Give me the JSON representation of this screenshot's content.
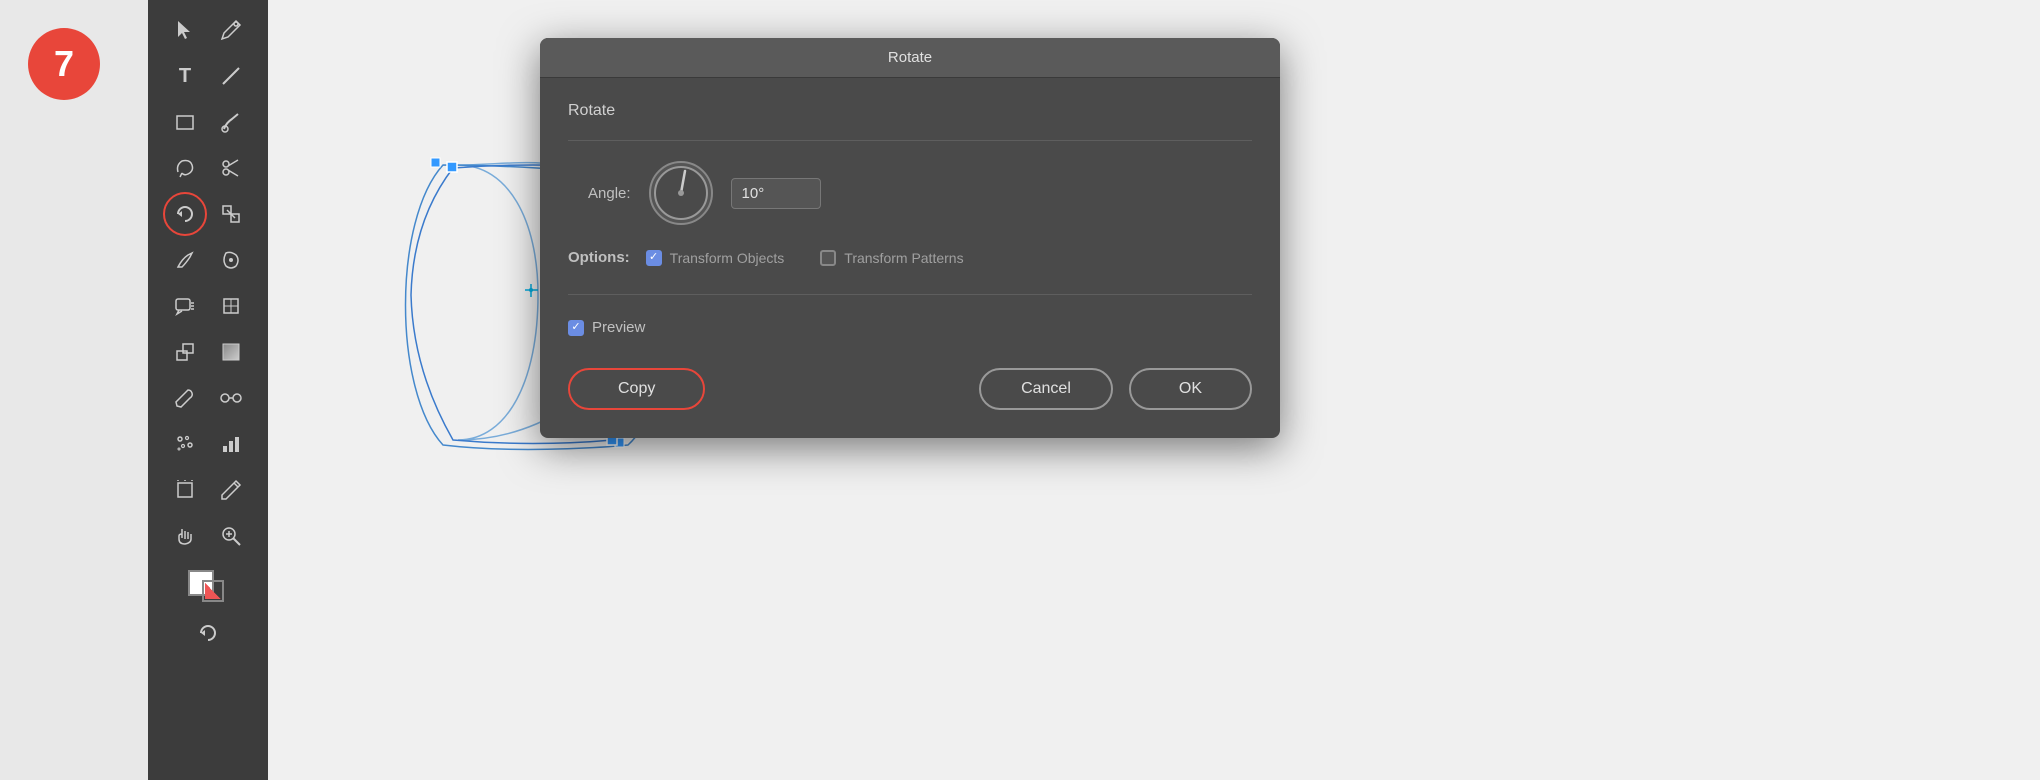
{
  "badge": {
    "number": "7"
  },
  "dialog": {
    "title": "Rotate",
    "section_title": "Rotate",
    "angle_label": "Angle:",
    "angle_value": "10°",
    "options_label": "Options:",
    "transform_objects_label": "Transform Objects",
    "transform_objects_checked": true,
    "transform_patterns_label": "Transform Patterns",
    "transform_patterns_checked": false,
    "preview_label": "Preview",
    "preview_checked": true,
    "copy_button": "Copy",
    "cancel_button": "Cancel",
    "ok_button": "OK"
  },
  "toolbar": {
    "tools": [
      {
        "name": "selection",
        "icon": "↖"
      },
      {
        "name": "pen",
        "icon": "✒"
      },
      {
        "name": "text",
        "icon": "T"
      },
      {
        "name": "line",
        "icon": "/"
      },
      {
        "name": "rectangle",
        "icon": "□"
      },
      {
        "name": "paintbrush",
        "icon": "✏"
      },
      {
        "name": "scissors",
        "icon": "✂"
      },
      {
        "name": "transform",
        "icon": "⊞"
      },
      {
        "name": "rotate",
        "icon": "↺",
        "active": true
      },
      {
        "name": "reflect",
        "icon": "⊡"
      },
      {
        "name": "knife",
        "icon": "✂"
      },
      {
        "name": "warp",
        "icon": "⤹"
      },
      {
        "name": "comment",
        "icon": "💬"
      },
      {
        "name": "mesh",
        "icon": "⊞"
      },
      {
        "name": "torn",
        "icon": "⊟"
      },
      {
        "name": "gradient",
        "icon": "▦"
      },
      {
        "name": "eyedropper",
        "icon": "⊾"
      },
      {
        "name": "blend",
        "icon": "◯"
      },
      {
        "name": "grid",
        "icon": "⊞"
      },
      {
        "name": "chart",
        "icon": "▦"
      },
      {
        "name": "artboard",
        "icon": "⬜"
      },
      {
        "name": "pencil",
        "icon": "✏"
      },
      {
        "name": "hand",
        "icon": "✋"
      },
      {
        "name": "zoom",
        "icon": "🔍"
      }
    ]
  }
}
